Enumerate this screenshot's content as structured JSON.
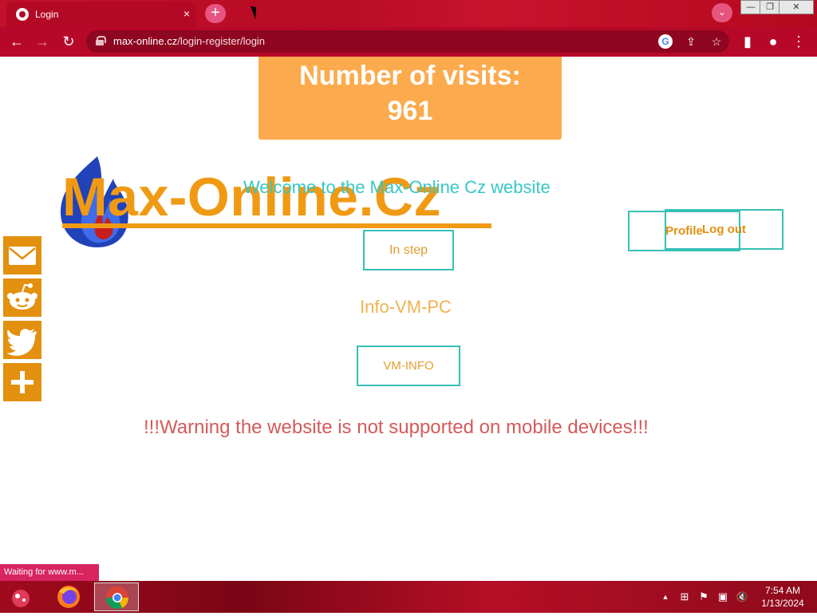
{
  "browser": {
    "tab_title": "Login",
    "tab_close": "×",
    "new_tab": "+",
    "profile_bubble": "⌄",
    "window_controls": {
      "minimize": "—",
      "restore": "❐",
      "close": "✕"
    },
    "nav": {
      "back": "←",
      "forward": "→",
      "reload": "↻"
    },
    "url_host": "max-online.cz",
    "url_path": "/login-register/login",
    "omni_icons": {
      "google": "G",
      "share": "⇪",
      "bookmark": "☆"
    },
    "right_icons": {
      "sidepanel": "▮",
      "account": "●",
      "menu": "⋮"
    }
  },
  "page": {
    "visits_label": "Number of visits:",
    "visits_count": "961",
    "logo_text": "Max-Online.Cz",
    "welcome": "Welcome to the Max-Online Cz website",
    "in_step_button": "In step",
    "profile_button": "Profile",
    "logout_button": "Log out",
    "info_vm_pc": "Info-VM-PC",
    "vm_info_button": "VM-INFO",
    "warning": "!!!Warning the website is not supported on mobile devices!!!",
    "share_buttons": [
      "email-icon",
      "reddit-icon",
      "twitter-icon",
      "add-icon"
    ],
    "status_text": "Waiting for www.m..."
  },
  "taskbar": {
    "apps": [
      "start-icon",
      "firefox-icon",
      "chrome-icon"
    ],
    "time": "7:54 AM",
    "date": "1/13/2024",
    "tray_icons": {
      "up": "▲",
      "network": "⊞",
      "flag": "⚑",
      "display": "▣",
      "volume": "🔇"
    }
  },
  "colors": {
    "accent_orange": "#fbab4d",
    "logo_orange": "#f09a14",
    "teal": "#38c7c7",
    "warning_red": "#d45a5a",
    "chrome_red": "#b8082a"
  }
}
